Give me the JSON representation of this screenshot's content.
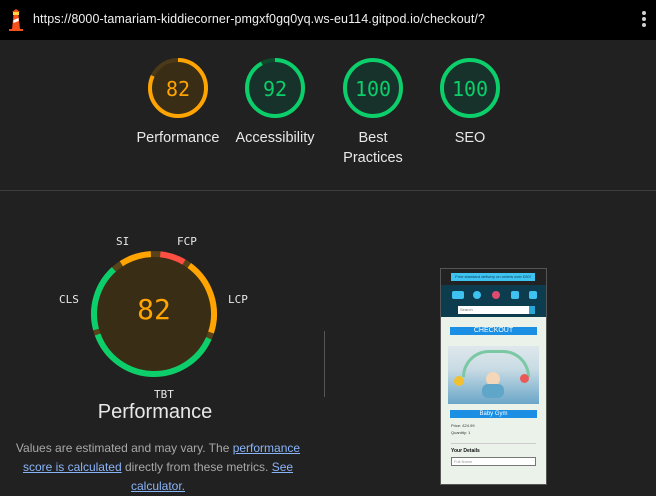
{
  "browser": {
    "url": "https://8000-tamariam-kiddiecorner-pmgxf0gq0yq.ws-eu114.gitpod.io/checkout/?",
    "icons": [
      "lighthouse-icon",
      "more-vert-icon"
    ]
  },
  "categories": [
    {
      "name": "Performance",
      "score": "82",
      "fraction": 0.82,
      "color": "#ffa400"
    },
    {
      "name": "Accessibility",
      "score": "92",
      "fraction": 0.92,
      "color": "#0cce6b"
    },
    {
      "name": "Best Practices",
      "score": "100",
      "fraction": 1.0,
      "color": "#0cce6b"
    },
    {
      "name": "SEO",
      "score": "100",
      "fraction": 1.0,
      "color": "#0cce6b"
    }
  ],
  "performance": {
    "score": "82",
    "title": "Performance",
    "metrics": {
      "si": "SI",
      "fcp": "FCP",
      "lcp": "LCP",
      "tbt": "TBT",
      "cls": "CLS"
    },
    "metric_colors": {
      "SI": "#ffa400",
      "FCP": "#ff4e42",
      "LCP": "#ffa400",
      "TBT": "#0cce6b",
      "CLS": "#0cce6b"
    },
    "note_prefix": "Values are estimated and may vary. The ",
    "note_link1": "performance score is calculated",
    "note_mid": " directly from these metrics. ",
    "note_link2": "See calculator."
  },
  "screenshot": {
    "banner": "Free standard delivery on orders over £50!",
    "search_placeholder": "Search",
    "heading": "CHECKOUT",
    "product": "Baby Gym",
    "price": "Price: £24.99",
    "quantity": "Quantity: 1",
    "section": "Your Details",
    "input_placeholder": "Full Name"
  }
}
